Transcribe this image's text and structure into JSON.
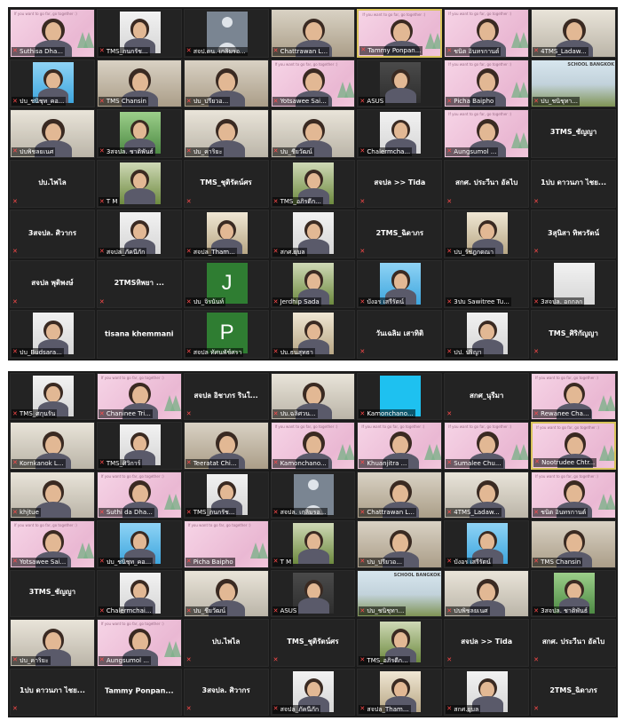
{
  "slide_caption": "If you want to go far, go together :)",
  "school_banner": "SCHOOL BANGKOK",
  "grid1": [
    {
      "label": "Suthisa Dha...",
      "mic": "muted",
      "center": "",
      "bg": "pink",
      "fig": true
    },
    {
      "label": "TMS_กนกรัช...",
      "mic": "muted",
      "center": "",
      "bg": "white",
      "fig": true
    },
    {
      "label": "สจป.ดน. เกลิมรอ...",
      "mic": "muted",
      "center": "",
      "bg": "avatar",
      "fig": false
    },
    {
      "label": "Chattrawan L...",
      "mic": "muted",
      "center": "",
      "bg": "room",
      "fig": true
    },
    {
      "label": "Tammy Ponpan...",
      "mic": "muted",
      "center": "",
      "bg": "pink",
      "fig": true,
      "active": true
    },
    {
      "label": "ชนิต อินทรกานต์",
      "mic": "muted",
      "center": "",
      "bg": "pink",
      "fig": true
    },
    {
      "label": "4TMS_Ladaw...",
      "mic": "muted",
      "center": "",
      "bg": "office",
      "fig": true
    },
    {
      "label": "ปบ_ชนิชุท_คอ...",
      "mic": "muted",
      "center": "",
      "bg": "blue",
      "fig": true
    },
    {
      "label": "TMS Chansin",
      "mic": "muted",
      "center": "",
      "bg": "room",
      "fig": true
    },
    {
      "label": "ปบ_ปรียวอ...",
      "mic": "muted",
      "center": "",
      "bg": "room",
      "fig": true
    },
    {
      "label": "Yotsawee Sai...",
      "mic": "muted",
      "center": "",
      "bg": "pink",
      "fig": true
    },
    {
      "label": "ASUS",
      "mic": "muted",
      "center": "",
      "bg": "dark",
      "fig": true
    },
    {
      "label": "Picha Baipho",
      "mic": "muted",
      "center": "",
      "bg": "pink",
      "fig": true
    },
    {
      "label": "ปบ_ชนิชุทา...",
      "mic": "muted",
      "center": "",
      "bg": "school",
      "fig": false
    },
    {
      "label": "ปบพิชลยเนศ",
      "mic": "muted",
      "center": "",
      "bg": "office",
      "fig": true
    },
    {
      "label": "3สจปล. ชาติพันธ์",
      "mic": "muted",
      "center": "",
      "bg": "green",
      "fig": true
    },
    {
      "label": "ปบ_คาริยะ",
      "mic": "muted",
      "center": "",
      "bg": "office",
      "fig": true
    },
    {
      "label": "ปบ_ชียวัฒน์",
      "mic": "muted",
      "center": "",
      "bg": "office",
      "fig": true
    },
    {
      "label": "Chalermcha...",
      "mic": "muted",
      "center": "",
      "bg": "white",
      "fig": true
    },
    {
      "label": "Aungsumol ...",
      "mic": "muted",
      "center": "",
      "bg": "pink",
      "fig": true
    },
    {
      "label": "",
      "mic": "none",
      "center": "3TMS_ชัญญา",
      "bg": "none",
      "fig": false
    },
    {
      "label": "",
      "mic": "muted",
      "center": "ปบ.ไพไล",
      "bg": "none",
      "fig": false
    },
    {
      "label": "T M",
      "mic": "muted",
      "center": "",
      "bg": "nature",
      "fig": true
    },
    {
      "label": "",
      "mic": "muted",
      "center": "TMS_ชุติรัตน์ศร",
      "bg": "none",
      "fig": false
    },
    {
      "label": "TMS_อภิรดีก...",
      "mic": "muted",
      "center": "",
      "bg": "nature",
      "fig": true
    },
    {
      "label": "",
      "mic": "muted",
      "center": "สจปล >> Tida",
      "bg": "none",
      "fig": false
    },
    {
      "label": "",
      "mic": "muted",
      "center": "สกศ. ประวีนา อัลไบ",
      "bg": "none",
      "fig": false
    },
    {
      "label": "",
      "mic": "muted",
      "center": "1ปบ ดาวนภา ไชย...",
      "bg": "none",
      "fig": false
    },
    {
      "label": "",
      "mic": "muted",
      "center": "3สจปล. ศิวากร",
      "bg": "none",
      "fig": false
    },
    {
      "label": "สจปล_ภัคนีภัก",
      "mic": "muted",
      "center": "",
      "bg": "white",
      "fig": true
    },
    {
      "label": "สจปล_Tham...",
      "mic": "muted",
      "center": "",
      "bg": "street",
      "fig": true
    },
    {
      "label": "สกศ.ยุบล",
      "mic": "muted",
      "center": "",
      "bg": "white",
      "fig": true
    },
    {
      "label": "",
      "mic": "muted",
      "center": "2TMS_ฉิดาภร",
      "bg": "none",
      "fig": false
    },
    {
      "label": "ปบ_รัชฎกดณา",
      "mic": "muted",
      "center": "",
      "bg": "street",
      "fig": true
    },
    {
      "label": "",
      "mic": "muted",
      "center": "3สุนิสา ทิพวรัตน์",
      "bg": "none",
      "fig": false
    },
    {
      "label": "",
      "mic": "muted",
      "center": "สจปล พุติพงษ์",
      "bg": "none",
      "fig": false
    },
    {
      "label": "",
      "mic": "muted",
      "center": "2TMSทิพยา ...",
      "bg": "none",
      "fig": false
    },
    {
      "label": "ปบ_จิรนันท์",
      "mic": "muted",
      "center": "",
      "bg": "letterJ",
      "fig": false
    },
    {
      "label": "Jerdhip Sada",
      "mic": "muted",
      "center": "",
      "bg": "nature",
      "fig": true
    },
    {
      "label": "บังอร เสรีรัตน์",
      "mic": "muted",
      "center": "",
      "bg": "blue",
      "fig": true
    },
    {
      "label": "3ปบ Sawitree Tu...",
      "mic": "muted",
      "center": "",
      "bg": "none",
      "fig": false
    },
    {
      "label": "3สจปล. อกกลก",
      "mic": "muted",
      "center": "",
      "bg": "whitebox",
      "fig": false
    },
    {
      "label": "ปบ_Budsara...",
      "mic": "muted",
      "center": "",
      "bg": "white",
      "fig": true
    },
    {
      "label": "",
      "mic": "none",
      "center": "tisana khemmani",
      "bg": "none",
      "fig": false
    },
    {
      "label": "สจปล ทัศนพัช์ศรา",
      "mic": "muted",
      "center": "",
      "bg": "letterP",
      "fig": false
    },
    {
      "label": "ปบ.ธนสุทธา",
      "mic": "muted",
      "center": "",
      "bg": "street",
      "fig": true
    },
    {
      "label": "",
      "mic": "muted",
      "center": "วันเฉลิม เสาทิติ",
      "bg": "none",
      "fig": false
    },
    {
      "label": "ปป. ปริญา",
      "mic": "muted",
      "center": "",
      "bg": "white",
      "fig": true
    },
    {
      "label": "",
      "mic": "muted",
      "center": "TMS_ศิริกัญญา",
      "bg": "none",
      "fig": false
    }
  ],
  "grid2": [
    {
      "label": "TMS_ศกุนรัน",
      "mic": "muted",
      "center": "",
      "bg": "white",
      "fig": true
    },
    {
      "label": "Chaninee Tri...",
      "mic": "muted",
      "center": "",
      "bg": "pink",
      "fig": true
    },
    {
      "label": "",
      "mic": "muted",
      "center": "สจปล อิชาภร รินใ...",
      "bg": "none",
      "fig": false
    },
    {
      "label": "ปบ.ฉลิศวน...",
      "mic": "muted",
      "center": "",
      "bg": "office",
      "fig": true
    },
    {
      "label": "Kamonchano...",
      "mic": "muted",
      "center": "",
      "bg": "cyan",
      "fig": false
    },
    {
      "label": "",
      "mic": "muted",
      "center": "สกศ_นุรีมา",
      "bg": "none",
      "fig": false
    },
    {
      "label": "Rewanee Cha...",
      "mic": "muted",
      "center": "",
      "bg": "pink",
      "fig": true
    },
    {
      "label": "Kornkanok L...",
      "mic": "muted",
      "center": "",
      "bg": "office",
      "fig": true
    },
    {
      "label": "TMS_ศิวิการ์",
      "mic": "muted",
      "center": "",
      "bg": "white",
      "fig": true
    },
    {
      "label": "Teeratat Chi...",
      "mic": "muted",
      "center": "",
      "bg": "room",
      "fig": true
    },
    {
      "label": "Kamonchano...",
      "mic": "muted",
      "center": "",
      "bg": "pink",
      "fig": true
    },
    {
      "label": "Khuanjitra ...",
      "mic": "muted",
      "center": "",
      "bg": "pink",
      "fig": true
    },
    {
      "label": "Sumalee Chu...",
      "mic": "muted",
      "center": "",
      "bg": "pink",
      "fig": true
    },
    {
      "label": "Nootrudee Chtr...",
      "mic": "muted",
      "center": "",
      "bg": "pink",
      "fig": true,
      "active": true
    },
    {
      "label": "khjtue",
      "mic": "muted",
      "center": "",
      "bg": "office",
      "fig": true
    },
    {
      "label": "Suthi da Dha...",
      "mic": "muted",
      "center": "",
      "bg": "pink",
      "fig": true
    },
    {
      "label": "TMS_กนกรัช...",
      "mic": "muted",
      "center": "",
      "bg": "white",
      "fig": true
    },
    {
      "label": "สจปล. เกลิมรอ...",
      "mic": "muted",
      "center": "",
      "bg": "avatar",
      "fig": false
    },
    {
      "label": "Chattrawan L...",
      "mic": "muted",
      "center": "",
      "bg": "room",
      "fig": true
    },
    {
      "label": "4TMS_Ladaw...",
      "mic": "muted",
      "center": "",
      "bg": "office",
      "fig": true
    },
    {
      "label": "ชนิต อินทรกานต์",
      "mic": "muted",
      "center": "",
      "bg": "pink",
      "fig": true
    },
    {
      "label": "Yotsawee Sai...",
      "mic": "muted",
      "center": "",
      "bg": "pink",
      "fig": true
    },
    {
      "label": "ปบ_ชนิชุท_คอ...",
      "mic": "muted",
      "center": "",
      "bg": "blue",
      "fig": true
    },
    {
      "label": "Picha Baipho",
      "mic": "muted",
      "center": "",
      "bg": "pink",
      "fig": false
    },
    {
      "label": "T M",
      "mic": "muted",
      "center": "",
      "bg": "nature",
      "fig": true
    },
    {
      "label": "ปบ_ปรียวอ...",
      "mic": "muted",
      "center": "",
      "bg": "room",
      "fig": true
    },
    {
      "label": "บังอร เสรีรัตน์",
      "mic": "muted",
      "center": "",
      "bg": "blue",
      "fig": true
    },
    {
      "label": "TMS Chansin",
      "mic": "muted",
      "center": "",
      "bg": "room",
      "fig": true
    },
    {
      "label": "",
      "mic": "none",
      "center": "3TMS_ชัญญา",
      "bg": "none",
      "fig": false
    },
    {
      "label": "Chalermchai...",
      "mic": "muted",
      "center": "",
      "bg": "white",
      "fig": true
    },
    {
      "label": "ปบ_ชียวัฒน์",
      "mic": "muted",
      "center": "",
      "bg": "office",
      "fig": true
    },
    {
      "label": "ASUS",
      "mic": "muted",
      "center": "",
      "bg": "dark",
      "fig": true
    },
    {
      "label": "ปบ_ชนิชุทา...",
      "mic": "muted",
      "center": "",
      "bg": "school",
      "fig": false
    },
    {
      "label": "ปบพิชลยเนศ",
      "mic": "muted",
      "center": "",
      "bg": "office",
      "fig": true
    },
    {
      "label": "3สจปล. ชาติพันธ์",
      "mic": "muted",
      "center": "",
      "bg": "green",
      "fig": true
    },
    {
      "label": "ปบ_คาริยะ",
      "mic": "muted",
      "center": "",
      "bg": "office",
      "fig": true
    },
    {
      "label": "Aungsumol ...",
      "mic": "muted",
      "center": "",
      "bg": "pink",
      "fig": true
    },
    {
      "label": "",
      "mic": "muted",
      "center": "ปบ.ไพไล",
      "bg": "none",
      "fig": false
    },
    {
      "label": "",
      "mic": "muted",
      "center": "TMS_ชุติรัตน์ศร",
      "bg": "none",
      "fig": false
    },
    {
      "label": "TMS_อภิรดีก...",
      "mic": "muted",
      "center": "",
      "bg": "nature",
      "fig": true
    },
    {
      "label": "",
      "mic": "muted",
      "center": "สจปล >> Tida",
      "bg": "none",
      "fig": false
    },
    {
      "label": "",
      "mic": "muted",
      "center": "สกศ. ประวีนา อัลไบ",
      "bg": "none",
      "fig": false
    },
    {
      "label": "",
      "mic": "muted",
      "center": "1ปบ ดาวนภา ไชย...",
      "bg": "none",
      "fig": false
    },
    {
      "label": "",
      "mic": "none",
      "center": "Tammy Ponpan...",
      "bg": "none",
      "fig": false
    },
    {
      "label": "",
      "mic": "muted",
      "center": "3สจปล. ศิวากร",
      "bg": "none",
      "fig": false
    },
    {
      "label": "สจปล_ภัคนีภัก",
      "mic": "muted",
      "center": "",
      "bg": "white",
      "fig": true
    },
    {
      "label": "สจปล_Tham...",
      "mic": "muted",
      "center": "",
      "bg": "street",
      "fig": true
    },
    {
      "label": "สกศ.ยุบล",
      "mic": "muted",
      "center": "",
      "bg": "white",
      "fig": true
    },
    {
      "label": "",
      "mic": "muted",
      "center": "2TMS_ฉิดาภร",
      "bg": "none",
      "fig": false
    }
  ]
}
